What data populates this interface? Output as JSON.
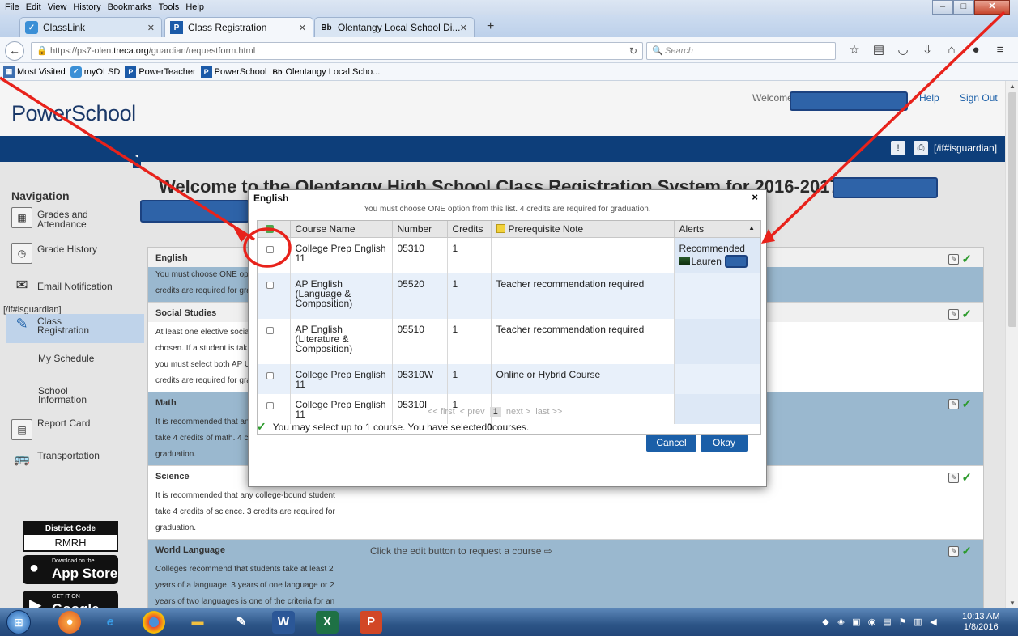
{
  "browser": {
    "menu": [
      "File",
      "Edit",
      "View",
      "History",
      "Bookmarks",
      "Tools",
      "Help"
    ],
    "tabs": [
      {
        "label": "ClassLink"
      },
      {
        "label": "Class Registration"
      },
      {
        "label": "Olentangy Local School Di..."
      }
    ],
    "url_prefix": "https://ps7-olen.",
    "url_domain": "treca.org",
    "url_suffix": "/guardian/requestform.html",
    "search_placeholder": "Search",
    "bookmarks": [
      "Most Visited",
      "myOLSD",
      "PowerTeacher",
      "PowerSchool",
      "Olentangy Local Scho..."
    ]
  },
  "header": {
    "logo": "PowerSchool",
    "welcome": "Welcome",
    "help": "Help",
    "signout": "Sign Out",
    "guardian_tag": "[/if#isguardian]"
  },
  "sidebar": {
    "title": "Navigation",
    "items": [
      {
        "label": "Grades and Attendance"
      },
      {
        "label": "Grade History"
      },
      {
        "label": "Email Notification"
      },
      {
        "label": "Class Registration"
      },
      {
        "label": "My Schedule"
      },
      {
        "label": "School Information"
      },
      {
        "label": "Report Card"
      },
      {
        "label": "Transportation"
      }
    ],
    "guardian_tag": "[/if#isguardian]",
    "district_title": "District Code",
    "district_code": "RMRH",
    "appstore_small": "Download on the",
    "appstore_big": "App Store",
    "googleplay_small": "GET IT ON",
    "googleplay_big": "Google play"
  },
  "main": {
    "title": "Welcome to the Olentangy High School Class Registration System for 2016-2017 :",
    "sections": [
      {
        "name": "English",
        "text": "You must choose ONE option from this list. 4\ncredits are required for graduation."
      },
      {
        "name": "Social Studies",
        "text": "At least one elective social studies course must be\nchosen. If a student is taking AP U.S. Government,\nyou must select both AP U.S. Government. 3\ncredits are required for graduation."
      },
      {
        "name": "Math",
        "text": "It is recommended that any college-bound student\ntake 4 credits of math. 4 credits are required for\ngraduation."
      },
      {
        "name": "Science",
        "text": "It is recommended that any college-bound student\ntake 4 credits of science. 3 credits are required for\ngraduation."
      },
      {
        "name": "World Language",
        "text": "Colleges recommend that students take at least 2\nyears of a language. 3 years of one language or 2\nyears of two languages is one of the criteria for an"
      }
    ],
    "hint": "Click the edit button to request a course ⇨"
  },
  "modal": {
    "title": "English",
    "close": "×",
    "instruction": "You must choose ONE option from this list. 4 credits are required for graduation.",
    "columns": [
      "Course Name",
      "Number",
      "Credits",
      "Prerequisite Note",
      "Alerts"
    ],
    "rows": [
      {
        "course": "College Prep English 11",
        "number": "05310",
        "credits": "1",
        "prereq": "",
        "alert": "Recommended"
      },
      {
        "course": "AP English (Language & Composition)",
        "number": "05520",
        "credits": "1",
        "prereq": "Teacher recommendation required",
        "alert": ""
      },
      {
        "course": "AP English (Literature & Composition)",
        "number": "05510",
        "credits": "1",
        "prereq": "Teacher recommendation required",
        "alert": ""
      },
      {
        "course": "College Prep English 11",
        "number": "05310W",
        "credits": "1",
        "prereq": "Online or Hybrid Course",
        "alert": ""
      },
      {
        "course": "College Prep English 11",
        "number": "05310I",
        "credits": "1",
        "prereq": "",
        "alert": ""
      }
    ],
    "alert_person": "Lauren",
    "pager_first": "<< first",
    "pager_prev": "< prev",
    "pager_current": "1",
    "pager_next": "next >",
    "pager_last": "last >>",
    "select_msg_pre": "You may select up to 1 course. You have selected ",
    "select_count": "0",
    "select_msg_post": " courses.",
    "cancel": "Cancel",
    "okay": "Okay"
  },
  "taskbar": {
    "time": "10:13 AM",
    "date": "1/8/2016"
  },
  "colors": {
    "annotation": "#e8221b",
    "ps_blue": "#0d3e7a",
    "section_body": "#9ab8cf"
  }
}
